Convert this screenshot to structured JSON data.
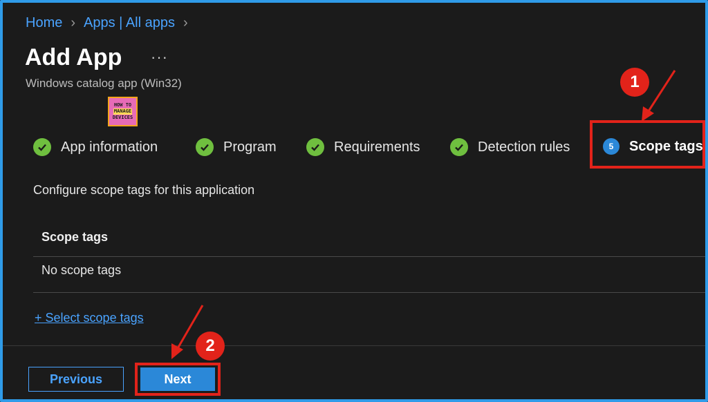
{
  "breadcrumb": {
    "home": "Home",
    "apps": "Apps | All apps"
  },
  "page": {
    "title": "Add App",
    "more": "···",
    "subtitle": "Windows catalog app (Win32)"
  },
  "logo": {
    "line1": "HOW TO",
    "line2": "MANAGE",
    "line3": "DEVICES"
  },
  "steps": [
    {
      "label": "App information",
      "state": "complete"
    },
    {
      "label": "Program",
      "state": "complete"
    },
    {
      "label": "Requirements",
      "state": "complete"
    },
    {
      "label": "Detection rules",
      "state": "complete"
    },
    {
      "label": "Scope tags",
      "state": "current",
      "number": "5"
    }
  ],
  "content": {
    "description": "Configure scope tags for this application",
    "table_header": "Scope tags",
    "table_empty": "No scope tags",
    "select_link": "+ Select scope tags"
  },
  "footer": {
    "previous": "Previous",
    "next": "Next"
  },
  "annotations": {
    "badge1": "1",
    "badge2": "2"
  },
  "colors": {
    "accent": "#2b88d8",
    "link": "#4aa3ff",
    "check": "#6fbf3f",
    "highlight": "#e2231a",
    "background": "#1b1b1b"
  }
}
